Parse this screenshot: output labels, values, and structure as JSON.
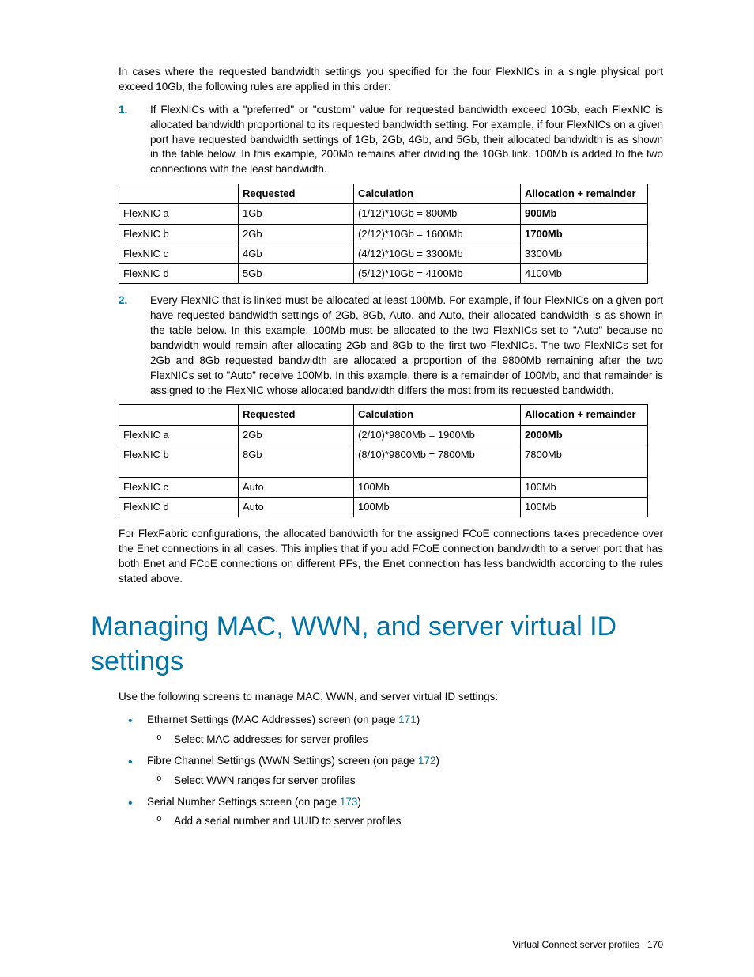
{
  "intro": "In cases where the requested bandwidth settings you specified for the four FlexNICs in a single physical port exceed 10Gb, the following rules are applied in this order:",
  "rule1": {
    "num": "1.",
    "text": "If FlexNICs with a \"preferred\" or \"custom\" value for requested bandwidth exceed 10Gb, each FlexNIC is allocated bandwidth proportional to its requested bandwidth setting. For example, if four FlexNICs on a given port have requested bandwidth settings of 1Gb, 2Gb, 4Gb, and 5Gb, their allocated bandwidth is as shown in the table below. In this example, 200Mb remains after dividing the 10Gb link. 100Mb is added to the two connections with the least bandwidth."
  },
  "table1": {
    "headers": [
      "",
      "Requested",
      "Calculation",
      "Allocation + remainder"
    ],
    "rows": [
      {
        "c0": "FlexNIC a",
        "c1": "1Gb",
        "c2": "(1/12)*10Gb = 800Mb",
        "c3": "900Mb",
        "bold3": true
      },
      {
        "c0": "FlexNIC b",
        "c1": "2Gb",
        "c2": "(2/12)*10Gb = 1600Mb",
        "c3": "1700Mb",
        "bold3": true
      },
      {
        "c0": "FlexNIC c",
        "c1": "4Gb",
        "c2": "(4/12)*10Gb = 3300Mb",
        "c3": "3300Mb",
        "bold3": false
      },
      {
        "c0": "FlexNIC d",
        "c1": "5Gb",
        "c2": "(5/12)*10Gb = 4100Mb",
        "c3": "4100Mb",
        "bold3": false
      }
    ]
  },
  "rule2": {
    "num": "2.",
    "text": "Every FlexNIC that is linked must be allocated at least 100Mb. For example, if four FlexNICs on a given port have requested bandwidth settings of 2Gb, 8Gb, Auto, and Auto, their allocated bandwidth is as shown in the table below. In this example, 100Mb must be allocated to the two FlexNICs set to \"Auto\" because no bandwidth would remain after allocating 2Gb and 8Gb to the first two FlexNICs. The two FlexNICs set for 2Gb and 8Gb requested bandwidth are allocated a proportion of the 9800Mb remaining after the two FlexNICs set to \"Auto\" receive 100Mb. In this example, there is a remainder of 100Mb, and that remainder is assigned to the FlexNIC whose allocated bandwidth differs the most from its requested bandwidth."
  },
  "table2": {
    "headers": [
      "",
      "Requested",
      "Calculation",
      "Allocation + remainder"
    ],
    "rows": [
      {
        "c0": "FlexNIC a",
        "c1": "2Gb",
        "c2": "(2/10)*9800Mb = 1900Mb",
        "c3": "2000Mb",
        "bold3": true,
        "tall": false
      },
      {
        "c0": "FlexNIC b",
        "c1": "8Gb",
        "c2": "(8/10)*9800Mb = 7800Mb",
        "c3": "7800Mb",
        "bold3": false,
        "tall": true
      },
      {
        "c0": "FlexNIC c",
        "c1": "Auto",
        "c2": "100Mb",
        "c3": "100Mb",
        "bold3": false,
        "tall": false
      },
      {
        "c0": "FlexNIC d",
        "c1": "Auto",
        "c2": "100Mb",
        "c3": "100Mb",
        "bold3": false,
        "tall": false
      }
    ]
  },
  "flexfabric": "For FlexFabric configurations, the allocated bandwidth for the assigned FCoE connections takes precedence over the Enet connections in all cases. This implies that if you add FCoE connection bandwidth to a server port that has both Enet and FCoE connections on different PFs, the Enet connection has less bandwidth according to the rules stated above.",
  "heading": "Managing MAC, WWN, and server virtual ID settings",
  "use_intro": "Use the following screens to manage MAC, WWN, and server virtual ID settings:",
  "bullets": [
    {
      "pre": "Ethernet Settings (MAC Addresses) screen (on page ",
      "link": "171",
      "post": ")",
      "sub": "Select MAC addresses for server profiles"
    },
    {
      "pre": "Fibre Channel Settings (WWN Settings) screen (on page ",
      "link": "172",
      "post": ")",
      "sub": "Select WWN ranges for server profiles"
    },
    {
      "pre": "Serial Number Settings screen (on page ",
      "link": "173",
      "post": ")",
      "sub": "Add a serial number and UUID to server profiles"
    }
  ],
  "footer": {
    "title": "Virtual Connect server profiles",
    "page": "170"
  }
}
